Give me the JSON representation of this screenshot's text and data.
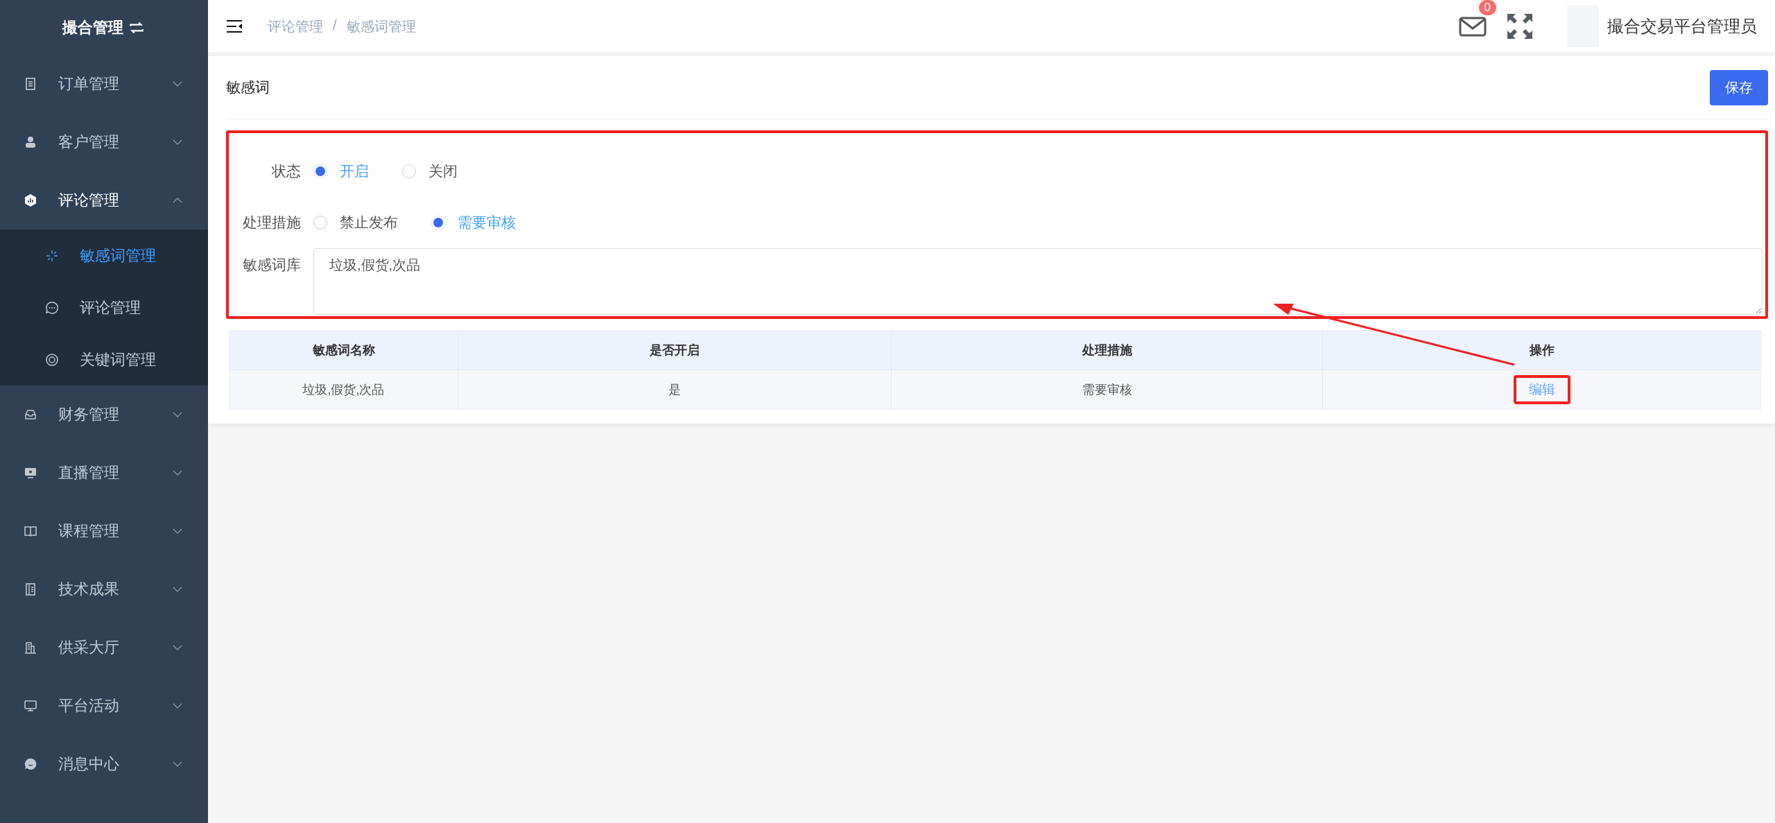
{
  "sidebar": {
    "title": "撮合管理",
    "items": [
      {
        "label": "订单管理",
        "expanded": false
      },
      {
        "label": "客户管理",
        "expanded": false
      },
      {
        "label": "评论管理",
        "expanded": true,
        "children": [
          {
            "label": "敏感词管理",
            "selected": true
          },
          {
            "label": "评论管理",
            "selected": false
          },
          {
            "label": "关键词管理",
            "selected": false
          }
        ]
      },
      {
        "label": "财务管理",
        "expanded": false
      },
      {
        "label": "直播管理",
        "expanded": false
      },
      {
        "label": "课程管理",
        "expanded": false
      },
      {
        "label": "技术成果",
        "expanded": false
      },
      {
        "label": "供采大厅",
        "expanded": false
      },
      {
        "label": "平台活动",
        "expanded": false
      },
      {
        "label": "消息中心",
        "expanded": false
      }
    ]
  },
  "header": {
    "breadcrumb": [
      "评论管理",
      "敏感词管理"
    ],
    "separator": "/",
    "mail_badge": "0",
    "user_name": "撮合交易平台管理员"
  },
  "card": {
    "title": "敏感词",
    "save_button": "保存",
    "form": {
      "status": {
        "label": "状态",
        "options": [
          {
            "label": "开启",
            "selected": true
          },
          {
            "label": "关闭",
            "selected": false
          }
        ]
      },
      "measure": {
        "label": "处理措施",
        "options": [
          {
            "label": "禁止发布",
            "selected": false
          },
          {
            "label": "需要审核",
            "selected": true
          }
        ]
      },
      "words": {
        "label": "敏感词库",
        "value": "垃圾,假货,次品"
      }
    },
    "table": {
      "columns": [
        "敏感词名称",
        "是否开启",
        "处理措施",
        "操作"
      ],
      "rows": [
        {
          "name": "垃圾,假货,次品",
          "enabled": "是",
          "measure": "需要审核",
          "action": "编辑"
        }
      ]
    }
  }
}
